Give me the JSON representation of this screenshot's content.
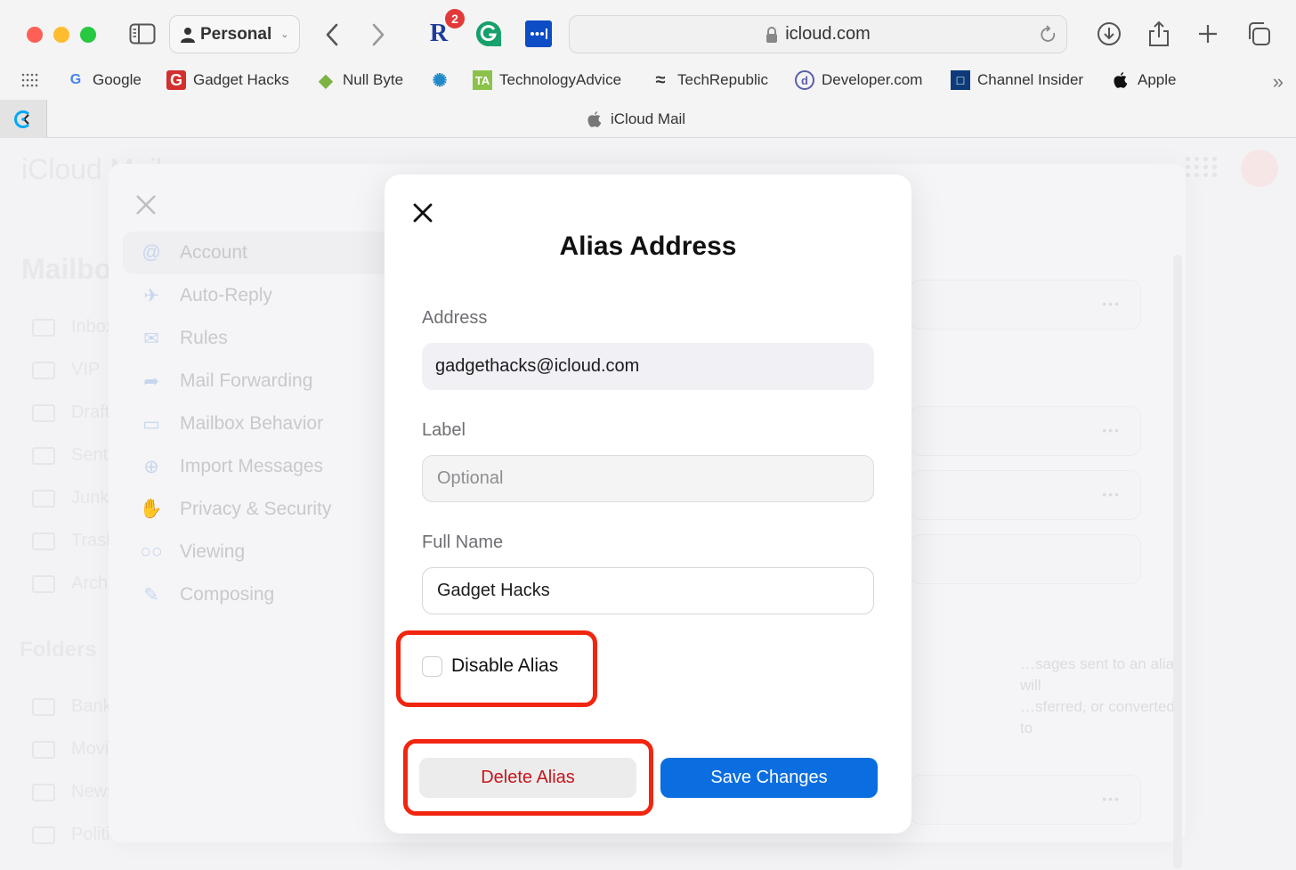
{
  "browser": {
    "profile_label": "Personal",
    "url": "icloud.com",
    "extensions": [
      {
        "name": "rakuten-extension",
        "glyph": "R",
        "badge": "2",
        "color": "#1d3c9c"
      },
      {
        "name": "grammarly-extension",
        "glyph": "G",
        "color": "#15a06c"
      },
      {
        "name": "lastpass-extension",
        "glyph": "•••|",
        "color": "#0c4cc4"
      }
    ],
    "bookmarks": [
      {
        "label": "Google",
        "icon": "google-icon",
        "glyph": "G",
        "color": "#4285f4"
      },
      {
        "label": "Gadget Hacks",
        "icon": "gadget-hacks-icon",
        "glyph": "G",
        "color": "#d32f2f"
      },
      {
        "label": "Null Byte",
        "icon": "null-byte-icon",
        "glyph": "◆",
        "color": "#7cb342"
      },
      {
        "label": "",
        "icon": "gear-eye-icon",
        "glyph": "✺",
        "color": "#1e88c8"
      },
      {
        "label": "TechnologyAdvice",
        "icon": "technologyadvice-icon",
        "glyph": "TA",
        "color": "#8bc34a"
      },
      {
        "label": "TechRepublic",
        "icon": "techrepublic-icon",
        "glyph": "≈",
        "color": "#333333"
      },
      {
        "label": "Developer.com",
        "icon": "developer-com-icon",
        "glyph": "d",
        "color": "#5a5fa8"
      },
      {
        "label": "Channel Insider",
        "icon": "channel-insider-icon",
        "glyph": "□",
        "color": "#0d3b7a"
      },
      {
        "label": "Apple",
        "icon": "apple-icon",
        "glyph": "",
        "color": "#111111"
      }
    ],
    "active_tab": "iCloud Mail"
  },
  "background": {
    "brand": "iCloud Mail",
    "mailboxes_title": "Mailboxes",
    "mailboxes": [
      "Inbox",
      "VIP",
      "Drafts",
      "Sent",
      "Junk",
      "Trash",
      "Archive"
    ],
    "folders_title": "Folders",
    "folders": [
      "Bank",
      "Movies",
      "News",
      "Politics"
    ],
    "settings_nav": [
      {
        "label": "Account",
        "icon": "at-icon",
        "active": true
      },
      {
        "label": "Auto-Reply",
        "icon": "airplane-icon",
        "active": false
      },
      {
        "label": "Rules",
        "icon": "envelope-rules-icon",
        "active": false
      },
      {
        "label": "Mail Forwarding",
        "icon": "forward-arrow-icon",
        "active": false
      },
      {
        "label": "Mailbox Behavior",
        "icon": "folder-icon",
        "active": false
      },
      {
        "label": "Import Messages",
        "icon": "download-circle-icon",
        "active": false
      },
      {
        "label": "Privacy & Security",
        "icon": "hand-icon",
        "active": false
      },
      {
        "label": "Viewing",
        "icon": "glasses-icon",
        "active": false
      },
      {
        "label": "Composing",
        "icon": "compose-icon",
        "active": false
      }
    ],
    "note_line1": "…sages sent to an alias will",
    "note_line2": "…sferred, or converted to"
  },
  "modal": {
    "title": "Alias Address",
    "address_label": "Address",
    "address_value": "gadgethacks@icloud.com",
    "label_label": "Label",
    "label_placeholder": "Optional",
    "label_value": "",
    "full_name_label": "Full Name",
    "full_name_value": "Gadget Hacks",
    "disable_alias_label": "Disable Alias",
    "disable_alias_checked": false,
    "delete_button": "Delete Alias",
    "save_button": "Save Changes"
  },
  "colors": {
    "save_button": "#0a6ee0",
    "delete_text": "#c4161c",
    "highlight": "#f2250f"
  }
}
